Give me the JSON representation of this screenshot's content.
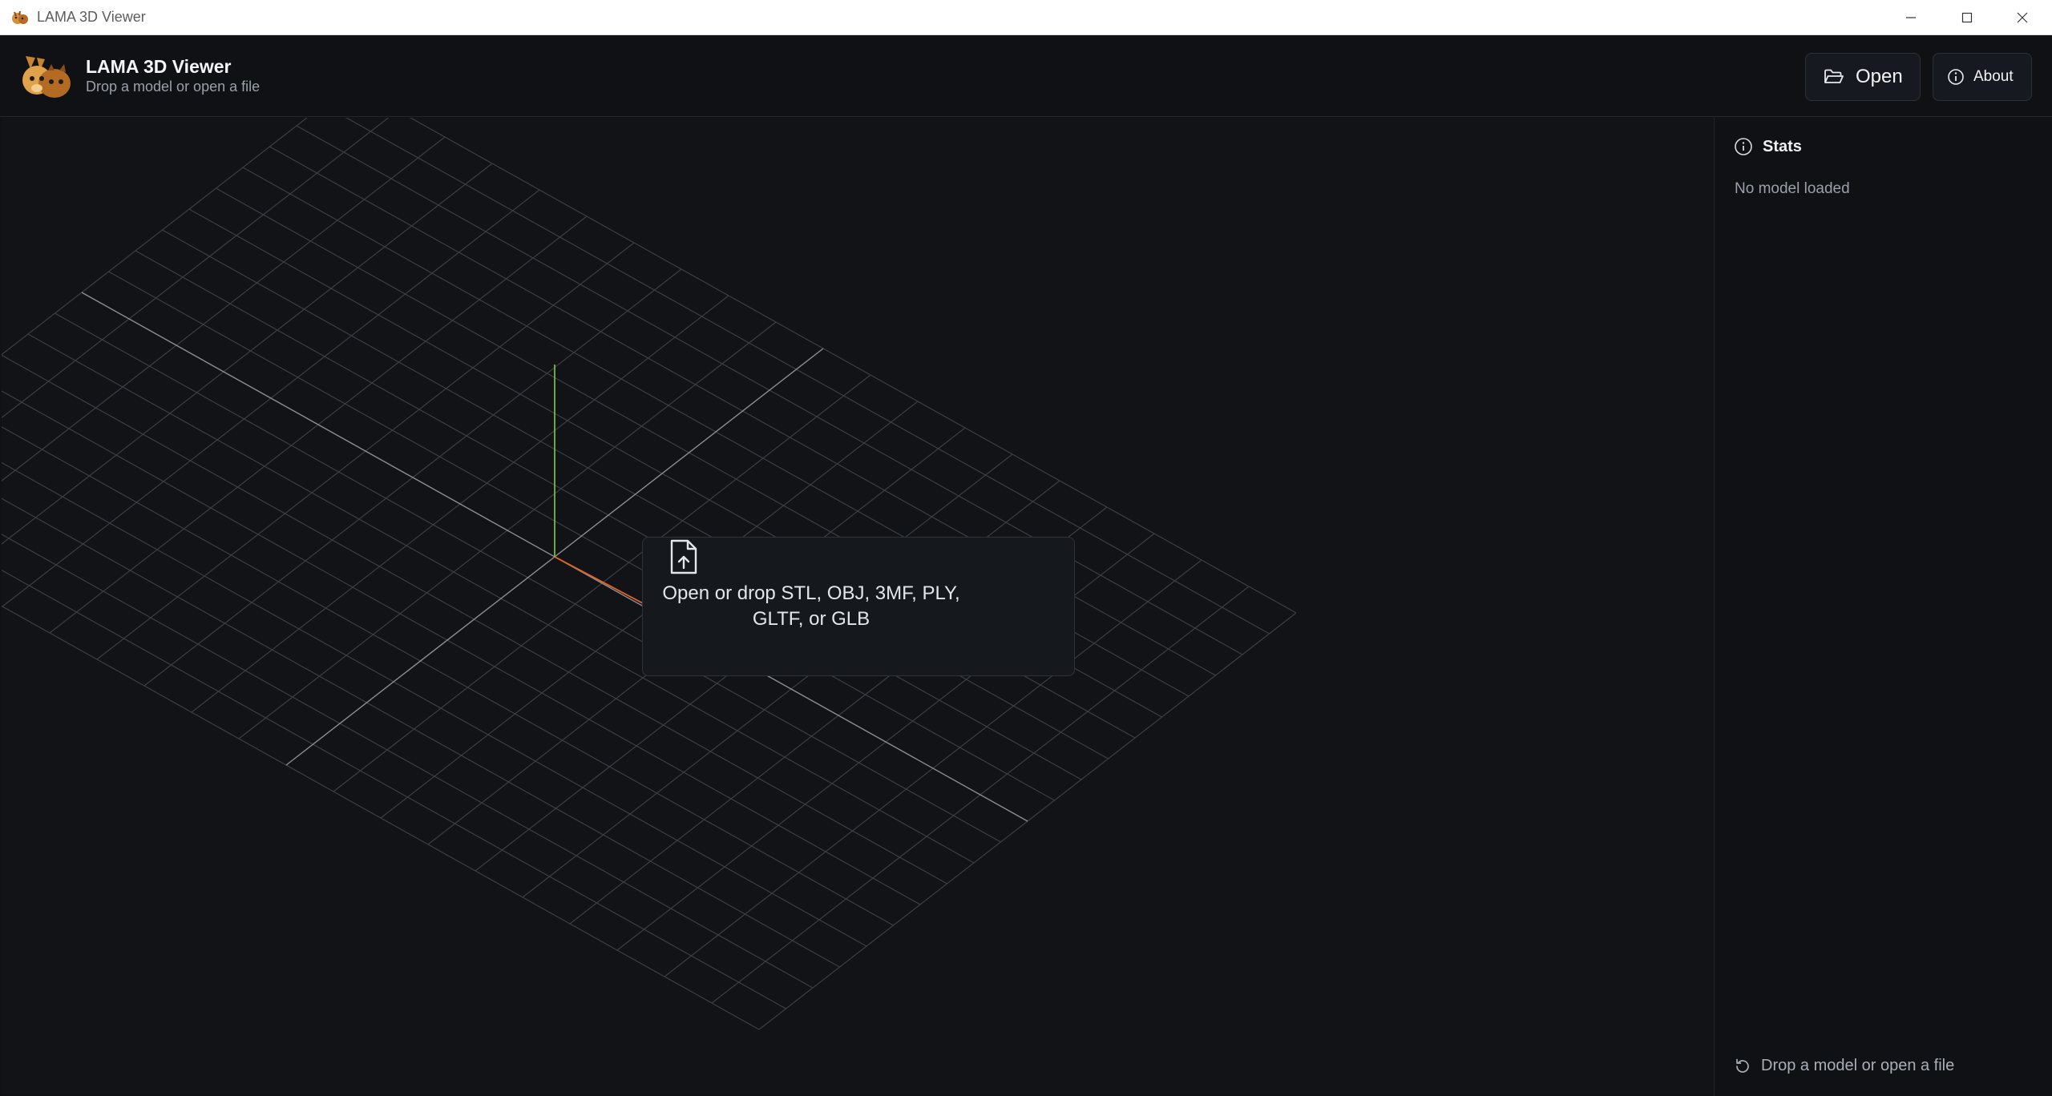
{
  "window": {
    "title": "LAMA 3D Viewer"
  },
  "header": {
    "title": "LAMA 3D Viewer",
    "subtitle": "Drop a model or open a file"
  },
  "toolbar": {
    "open_label": "Open",
    "about_label": "About"
  },
  "viewport": {
    "drop_message": "Open or drop STL, OBJ, 3MF, PLY, GLTF, or GLB"
  },
  "sidebar": {
    "stats_label": "Stats",
    "empty_text": "No model loaded"
  },
  "status": {
    "text": "Drop a model or open a file"
  },
  "icons": {
    "app": "llama-logo-icon",
    "open": "folder-open-icon",
    "about": "info-icon",
    "drop": "file-upload-icon",
    "stats": "info-icon",
    "status": "refresh-icon",
    "minimize": "minimize-icon",
    "maximize": "maximize-icon",
    "close": "close-icon"
  },
  "colors": {
    "axis_y": "#7fd13b",
    "axis_x": "#e8641e",
    "background": "#111317",
    "grid": "#3a3f47",
    "grid_main": "#8a8f96"
  }
}
